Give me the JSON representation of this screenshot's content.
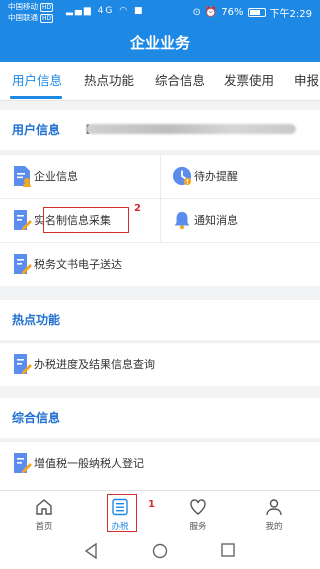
{
  "status_bar": {
    "carrier1": "中国移动",
    "carrier2": "中国联通",
    "hd": "HD",
    "signal_text": "4G",
    "battery": "76%",
    "battery_level": 0.76,
    "time": "下午2:29"
  },
  "header": {
    "title": "企业业务"
  },
  "tabs": [
    {
      "label": "用户信息",
      "active": true
    },
    {
      "label": "热点功能"
    },
    {
      "label": "综合信息"
    },
    {
      "label": "发票使用"
    },
    {
      "label": "申报"
    }
  ],
  "user_info": {
    "section_title": "用户信息",
    "bracket": "【"
  },
  "user_items": [
    {
      "label": "企业信息",
      "icon": "document-user-icon"
    },
    {
      "label": "待办提醒",
      "icon": "clock-alert-icon"
    },
    {
      "label": "实名制信息采集",
      "icon": "edit-document-icon"
    },
    {
      "label": "通知消息",
      "icon": "bell-icon"
    },
    {
      "label": "税务文书电子送达",
      "icon": "edit-document-icon"
    }
  ],
  "hot": {
    "section_title": "热点功能",
    "items": [
      {
        "label": "办税进度及结果信息查询",
        "icon": "edit-document-icon"
      }
    ]
  },
  "general": {
    "section_title": "综合信息",
    "items": [
      {
        "label": "增值税一般纳税人登记",
        "icon": "edit-document-icon"
      }
    ]
  },
  "annotations": {
    "marker1": "1",
    "marker2": "2"
  },
  "bottom_nav": [
    {
      "label": "首页",
      "icon": "home-icon"
    },
    {
      "label": "办税",
      "icon": "list-icon",
      "active": true
    },
    {
      "label": "服务",
      "icon": "heart-icon"
    },
    {
      "label": "我的",
      "icon": "person-icon"
    }
  ],
  "colors": {
    "primary": "#1e88e5",
    "annotation": "#d32f2f",
    "section_title": "#1e6fd0"
  }
}
